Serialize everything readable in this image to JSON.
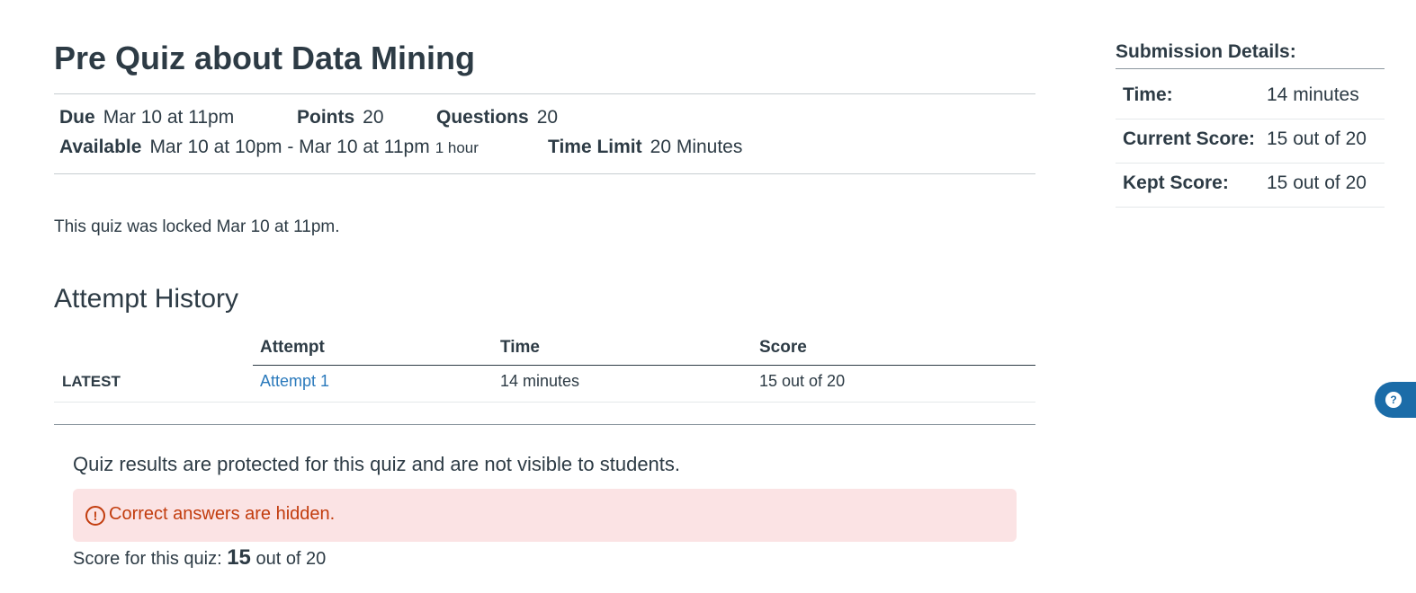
{
  "quiz": {
    "title": "Pre Quiz about Data Mining",
    "due_label": "Due",
    "due_value": "Mar 10 at 11pm",
    "points_label": "Points",
    "points_value": "20",
    "questions_label": "Questions",
    "questions_value": "20",
    "available_label": "Available",
    "available_value": "Mar 10 at 10pm - Mar 10 at 11pm",
    "available_duration": "1 hour",
    "time_limit_label": "Time Limit",
    "time_limit_value": "20 Minutes",
    "locked_message": "This quiz was locked Mar 10 at 11pm."
  },
  "history": {
    "title": "Attempt History",
    "columns": [
      "Attempt",
      "Time",
      "Score"
    ],
    "rows": [
      {
        "tag": "LATEST",
        "attempt": "Attempt 1",
        "time": "14 minutes",
        "score": "15 out of 20"
      }
    ]
  },
  "results": {
    "protected_message": "Quiz results are protected for this quiz and are not visible to students.",
    "alert_icon": "exclamation-circle-icon",
    "alert_text": "Correct answers are hidden.",
    "score_prefix": "Score for this quiz:",
    "score_value": "15",
    "score_suffix": "out of 20"
  },
  "submission": {
    "title": "Submission Details:",
    "time_label": "Time:",
    "time_value": "14 minutes",
    "current_label": "Current Score:",
    "current_value": "15 out of 20",
    "kept_label": "Kept Score:",
    "kept_value": "15 out of 20"
  },
  "floating_button": {
    "icon": "help-icon"
  },
  "colors": {
    "text": "#2d3b45",
    "link": "#2b7abc",
    "alert_bg": "#fbe3e4",
    "alert_text": "#c23c0d",
    "floating_button": "#1b6ca8"
  }
}
